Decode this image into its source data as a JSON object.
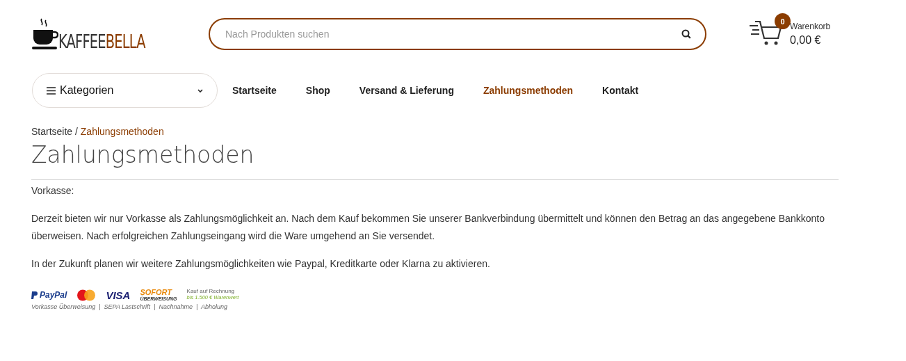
{
  "logo": {
    "part_1": "KAFFEE",
    "part_2": "BELLA"
  },
  "search": {
    "placeholder": "Nach Produkten suchen"
  },
  "cart": {
    "count": "0",
    "label": "Warenkorb",
    "total": "0,00 €"
  },
  "categories": {
    "label": "Kategorien"
  },
  "nav": [
    {
      "label": "Startseite",
      "selected": false
    },
    {
      "label": "Shop",
      "selected": false
    },
    {
      "label": "Versand & Lieferung",
      "selected": false
    },
    {
      "label": "Zahlungsmethoden",
      "selected": true
    },
    {
      "label": "Kontakt",
      "selected": false
    }
  ],
  "breadcrumb": [
    {
      "label": "Startseite",
      "current": false
    },
    {
      "label": "Zahlungsmethoden",
      "current": true
    }
  ],
  "breadcrumb_separator": "/",
  "title": "Zahlungsmethoden",
  "paragraphs": [
    "Vorkasse:",
    "Derzeit bieten wir nur Vorkasse als Zahlungsmöglichkeit an. Nach dem Kauf bekommen Sie unserer Bankverbindung übermittelt und können den Betrag an das angegebene Bankkonto überweisen. Nach erfolgreichen Zahlungseingang wird die Ware umgehend an Sie versendet.",
    "In der Zukunft planen wir weitere Zahlungsmöglichkeiten wie Paypal, Kreditkarte oder Klarna zu aktivieren."
  ],
  "payment_banner": {
    "paypal": "PayPal",
    "visa": "VISA",
    "sofort": "SOFORT",
    "sofort_sub": "ÜBERWEISUNG",
    "invoice": "Kauf auf Rechnung",
    "invoice_sub": "bis 1.500 € Warenwert",
    "caption": "Vorkasse Überweisung  |  SEPA Lastschrift  |  Nachnahme  |  Abholung"
  }
}
